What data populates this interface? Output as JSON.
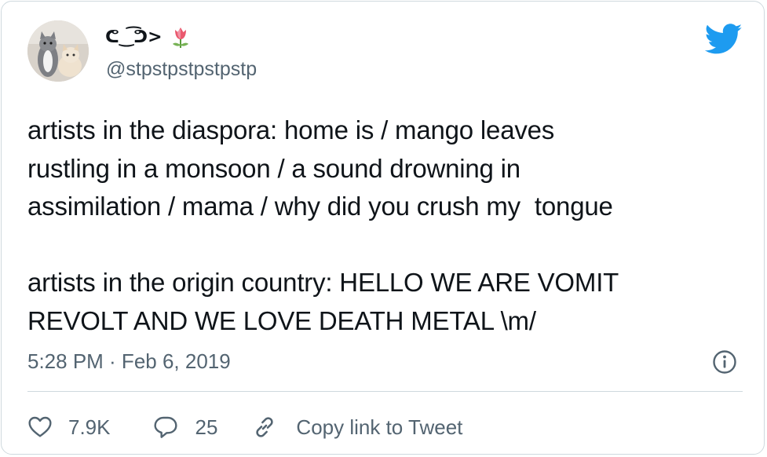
{
  "tweet": {
    "display_name": "ᕦ‿͡ᕤ>",
    "handle": "@stpstpstpstpstp",
    "text": "artists in the diaspora: home is / mango leaves\nrustling in a monsoon / a sound drowning in\nassimilation / mama / why did you crush my  tongue\n\nartists in the origin country: HELLO WE ARE VOMIT\nREVOLT AND WE LOVE DEATH METAL \\m/",
    "timestamp": "5:28 PM · Feb 6, 2019"
  },
  "actions": {
    "likes": "7.9K",
    "replies": "25",
    "copy_link_label": "Copy link to Tweet"
  },
  "icons": {
    "logo": "twitter-bird-icon",
    "emoji": "tulip-icon",
    "info": "info-icon",
    "like": "heart-icon",
    "reply": "speech-bubble-icon",
    "copy": "link-icon"
  },
  "colors": {
    "brand": "#1d9bf0",
    "text": "#0f1419",
    "secondary": "#536471",
    "border": "#cfd9de"
  }
}
